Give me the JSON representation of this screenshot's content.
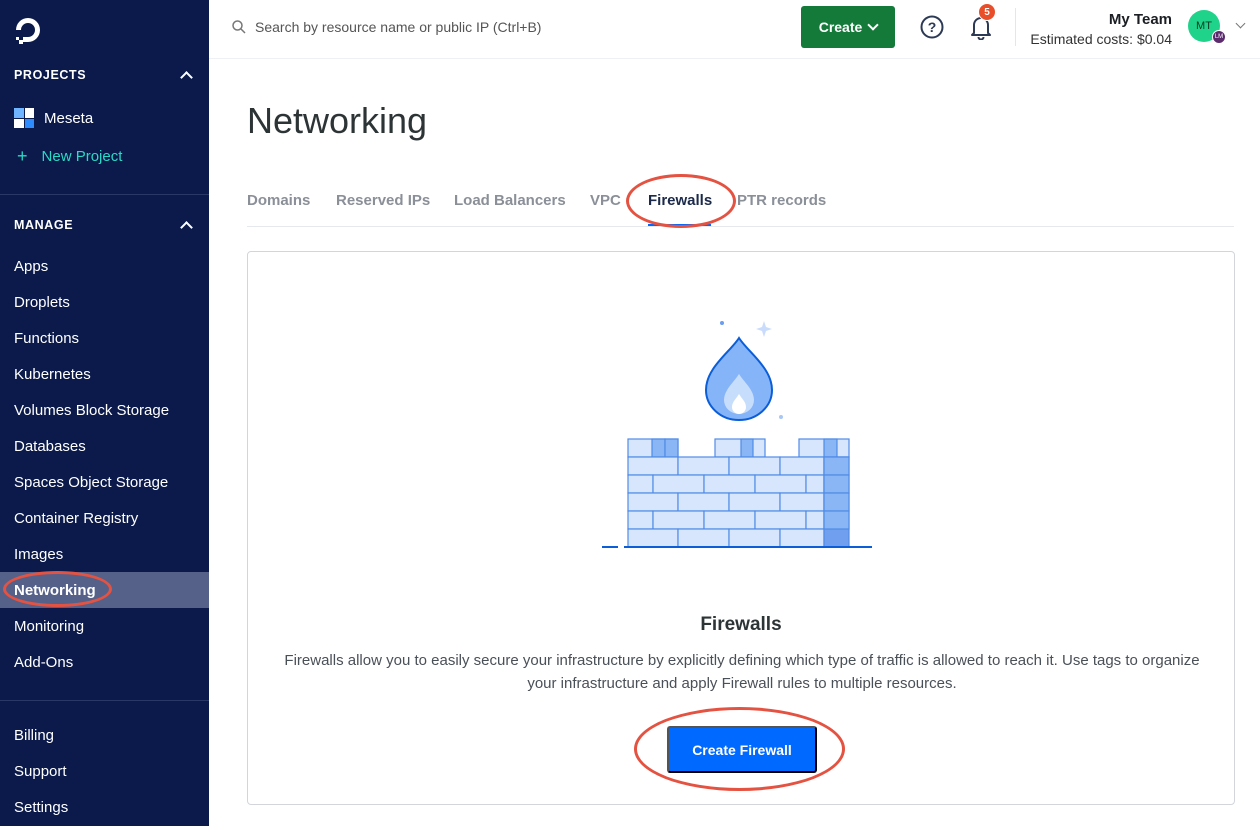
{
  "sidebar": {
    "projects_heading": "PROJECTS",
    "projects": [
      {
        "label": "Meseta"
      }
    ],
    "new_project_label": "New Project",
    "manage_heading": "MANAGE",
    "manage_items": [
      {
        "label": "Apps"
      },
      {
        "label": "Droplets"
      },
      {
        "label": "Functions"
      },
      {
        "label": "Kubernetes"
      },
      {
        "label": "Volumes Block Storage"
      },
      {
        "label": "Databases"
      },
      {
        "label": "Spaces Object Storage"
      },
      {
        "label": "Container Registry"
      },
      {
        "label": "Images"
      },
      {
        "label": "Networking",
        "active": true
      },
      {
        "label": "Monitoring"
      },
      {
        "label": "Add-Ons"
      }
    ],
    "footer_items": [
      {
        "label": "Billing"
      },
      {
        "label": "Support"
      },
      {
        "label": "Settings"
      }
    ]
  },
  "topbar": {
    "search_placeholder": "Search by resource name or public IP (Ctrl+B)",
    "create_label": "Create",
    "notifications_count": "5",
    "team_name": "My Team",
    "estimated_costs": "Estimated costs: $0.04",
    "avatar_initials": "MT",
    "avatar_mini_initials": "LM"
  },
  "main": {
    "title": "Networking",
    "tabs": [
      {
        "label": "Domains"
      },
      {
        "label": "Reserved IPs"
      },
      {
        "label": "Load Balancers"
      },
      {
        "label": "VPC"
      },
      {
        "label": "Firewalls",
        "active": true
      },
      {
        "label": "PTR records"
      }
    ],
    "empty_state": {
      "title": "Firewalls",
      "description": "Firewalls allow you to easily secure your infrastructure by explicitly defining which type of traffic is allowed to reach it. Use tags to organize your infrastructure and apply Firewall rules to multiple resources.",
      "button_label": "Create Firewall"
    }
  },
  "colors": {
    "sidebar_bg": "#0b1a4a",
    "accent_blue": "#0069ff",
    "create_green": "#147a3a",
    "callout_red": "#e45241",
    "new_project_teal": "#2bd9c6"
  }
}
